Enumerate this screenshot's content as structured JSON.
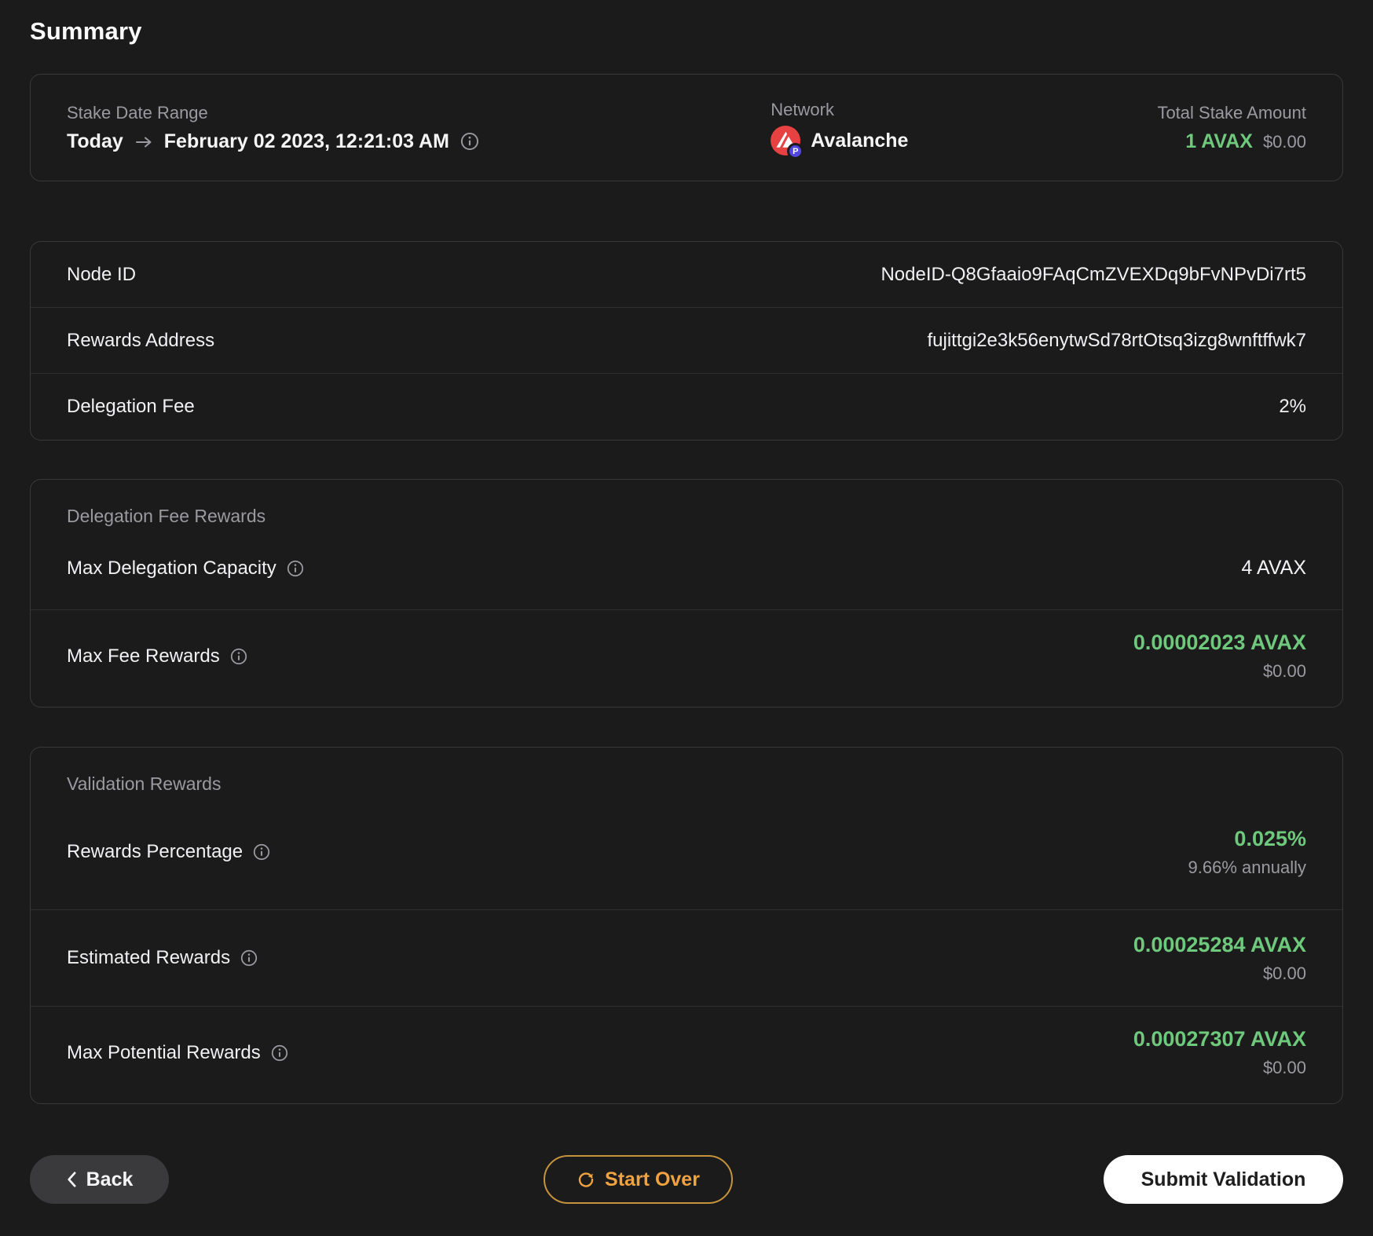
{
  "colors": {
    "background": "#1b1b1c",
    "card_border": "#39393c",
    "divider": "#2f2f31",
    "text_primary": "#f5f5f6",
    "text_secondary": "#9a9aa0",
    "accent_green": "#6ec97c",
    "accent_orange": "#f0a23f",
    "avalanche_red": "#e84142",
    "p_badge_blue": "#5246e0"
  },
  "page": {
    "title": "Summary"
  },
  "summary_card": {
    "stake_date_range": {
      "label": "Stake Date Range",
      "start": "Today",
      "end": "February 02 2023, 12:21:03 AM"
    },
    "network": {
      "label": "Network",
      "name": "Avalanche",
      "chain_badge": "P"
    },
    "total_stake": {
      "label": "Total Stake Amount",
      "amount": "1 AVAX",
      "usd_value": "$0.00"
    }
  },
  "details": {
    "rows": [
      {
        "label": "Node ID",
        "value": "NodeID-Q8Gfaaio9FAqCmZVEXDq9bFvNPvDi7rt5"
      },
      {
        "label": "Rewards Address",
        "value": "fujittgi2e3k56enytwSd78rtOtsq3izg8wnftffwk7"
      },
      {
        "label": "Delegation Fee",
        "value": "2%"
      }
    ]
  },
  "delegation_fee_rewards": {
    "section_label": "Delegation Fee Rewards",
    "max_delegation_capacity": {
      "label": "Max Delegation Capacity",
      "value": "4 AVAX"
    },
    "max_fee_rewards": {
      "label": "Max Fee Rewards",
      "amount": "0.00002023 AVAX",
      "usd_value": "$0.00"
    }
  },
  "validation_rewards": {
    "section_label": "Validation Rewards",
    "rewards_percentage": {
      "label": "Rewards Percentage",
      "value": "0.025%",
      "annual": "9.66% annually"
    },
    "estimated_rewards": {
      "label": "Estimated Rewards",
      "amount": "0.00025284 AVAX",
      "usd_value": "$0.00"
    },
    "max_potential_rewards": {
      "label": "Max Potential Rewards",
      "amount": "0.00027307 AVAX",
      "usd_value": "$0.00"
    }
  },
  "footer": {
    "back_label": "Back",
    "start_over_label": "Start Over",
    "submit_label": "Submit Validation"
  }
}
